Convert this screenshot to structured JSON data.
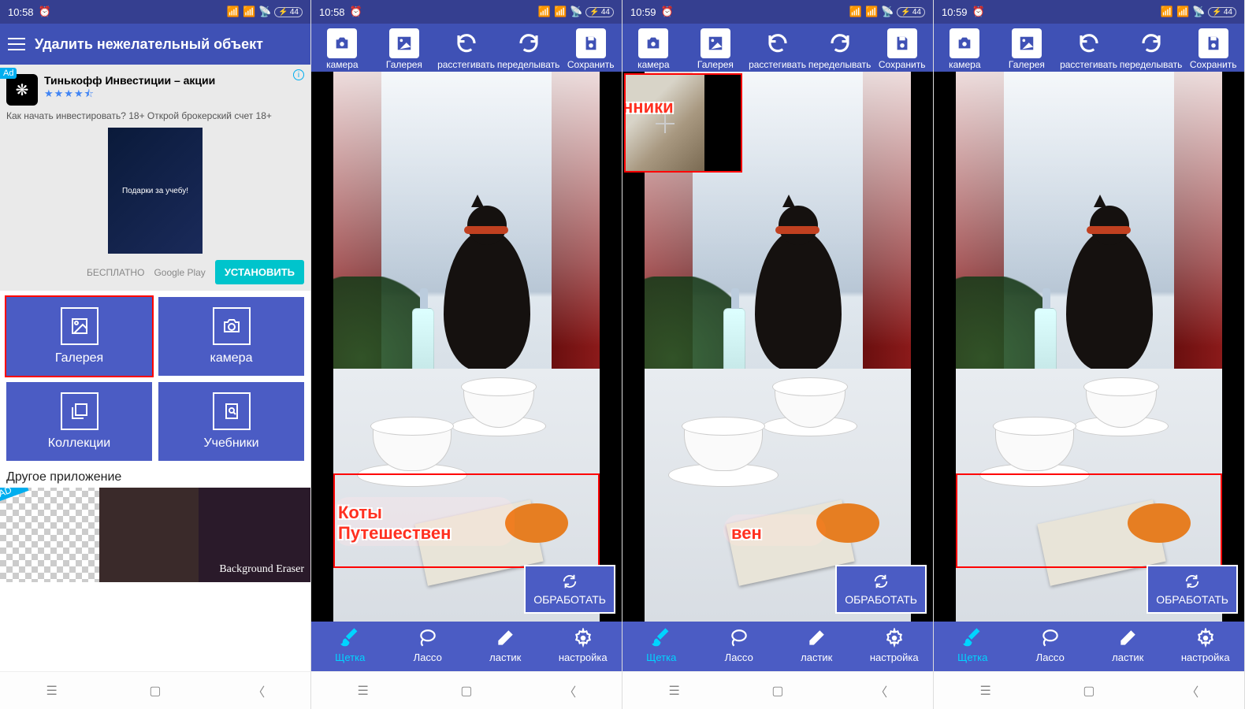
{
  "screens": [
    {
      "time": "10:58",
      "battery": "44"
    },
    {
      "time": "10:58",
      "battery": "44"
    },
    {
      "time": "10:59",
      "battery": "44"
    },
    {
      "time": "10:59",
      "battery": "44"
    }
  ],
  "home": {
    "title": "Удалить нежелательный объект",
    "ad": {
      "badge": "Ad",
      "title": "Тинькофф Инвестиции – акции",
      "stars": "★★★★⯪",
      "desc": "Как начать инвестировать? 18+ Открой брокерский счет 18+",
      "left": "БЕСПЛАТНО",
      "store": "Google Play",
      "install": "УСТАНОВИТЬ",
      "promo_tag": "Подарки за учебу!"
    },
    "buttons": {
      "gallery": "Галерея",
      "camera": "камера",
      "collections": "Коллекции",
      "tutorials": "Учебники"
    },
    "other_app": "Другое приложение",
    "bg_eraser": "Background Eraser",
    "ad_diag": "AD"
  },
  "editor": {
    "toolbar": {
      "camera": "камера",
      "gallery": "Галерея",
      "undo": "расстегивать",
      "redo": "переделывать",
      "save": "Сохранить"
    },
    "process": "ОБРАБОТАТЬ",
    "bottom": {
      "brush": "Щетка",
      "lasso": "Лассо",
      "eraser": "ластик",
      "settings": "настройка"
    },
    "watermark_line1": "Коты",
    "watermark_line2": "Путешествен",
    "mag_text": "нники",
    "watermark_s3": "вен"
  }
}
